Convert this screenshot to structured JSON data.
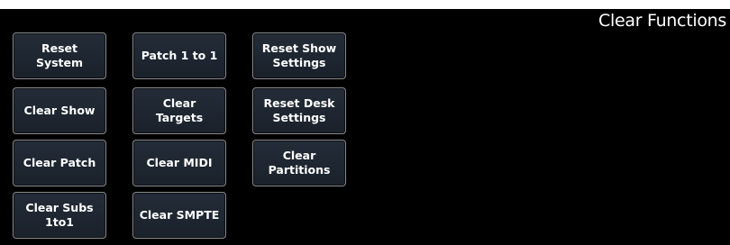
{
  "header": {
    "title": "Clear Functions"
  },
  "buttons": {
    "reset_system": "Reset System",
    "patch_1_to_1": "Patch 1 to 1",
    "reset_show_settings": "Reset Show\nSettings",
    "clear_show": "Clear Show",
    "clear_targets": "Clear Targets",
    "reset_desk_settings": "Reset Desk\nSettings",
    "clear_patch": "Clear Patch",
    "clear_midi": "Clear MIDI",
    "clear_partitions": "Clear\nPartitions",
    "clear_subs_1to1": "Clear Subs\n1to1",
    "clear_smpte": "Clear SMPTE"
  },
  "colors": {
    "background": "#000000",
    "button_face": "#1f2731",
    "button_border": "#8a8a8a",
    "text": "#ffffff"
  }
}
